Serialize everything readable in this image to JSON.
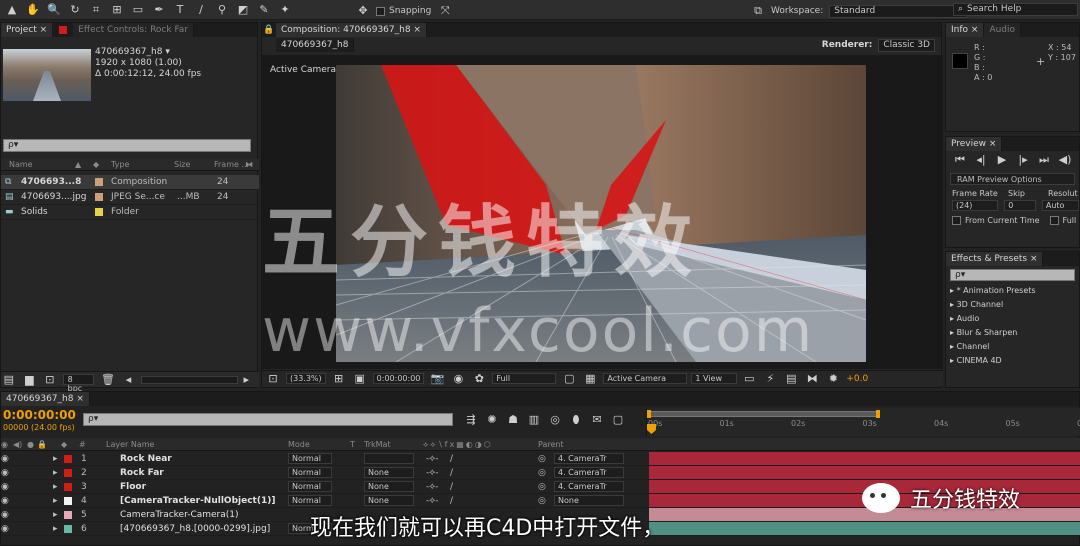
{
  "toolbar": {
    "snapping_label": "Snapping",
    "workspace_label": "Workspace:",
    "workspace_value": "Standard",
    "search_placeholder": "Search Help"
  },
  "project_panel": {
    "tab_project": "Project ×",
    "tab_effect_controls": "Effect Controls: Rock Far",
    "thumb_name": "470669367_h8 ▾",
    "thumb_dims": "1920 x 1080 (1.00)",
    "thumb_duration": "Δ 0:00:12:12, 24.00 fps",
    "col_name": "Name",
    "col_type": "Type",
    "col_size": "Size",
    "col_frame": "Frame ...",
    "items": [
      {
        "name": "4706693...8",
        "type": "Composition",
        "size": "",
        "frame": "24",
        "color": "#c9a27a",
        "icon": "composition-icon"
      },
      {
        "name": "4706693....jpg",
        "type": "JPEG Se...ce",
        "size": "...MB",
        "frame": "24",
        "color": "#c9a27a",
        "icon": "footage-icon"
      },
      {
        "name": "Solids",
        "type": "Folder",
        "size": "",
        "frame": "",
        "color": "#e3d24a",
        "icon": "folder-icon"
      }
    ],
    "bpc": "8 bpc"
  },
  "composition_panel": {
    "tab": "Composition: 470669367_h8 ×",
    "sub_tab": "470669367_h8",
    "renderer_label": "Renderer:",
    "renderer_value": "Classic 3D",
    "active_camera": "Active Camera",
    "zoom": "(33.3%)",
    "timecode": "0:00:00:00",
    "resolution": "Full",
    "camera": "Active Camera",
    "view": "1 View",
    "exposure": "+0.0"
  },
  "info_panel": {
    "tab_info": "Info ×",
    "tab_audio": "Audio",
    "r": "R :",
    "g": "G :",
    "b": "B :",
    "a": "A : 0",
    "x": "X : 54",
    "y": "Y : 107"
  },
  "preview_panel": {
    "tab": "Preview ×",
    "ram_options": "RAM Preview Options",
    "frame_rate_label": "Frame Rate",
    "skip_label": "Skip",
    "resolution_label": "Resolut",
    "frame_rate": "(24)",
    "skip": "0",
    "resolution": "Auto",
    "from_current": "From Current Time",
    "full": "Full"
  },
  "effects_panel": {
    "tab": "Effects & Presets ×",
    "search_placeholder": "ρ▾",
    "items": [
      "* Animation Presets",
      "3D Channel",
      "Audio",
      "Blur & Sharpen",
      "Channel",
      "CINEMA 4D"
    ]
  },
  "timeline": {
    "tab": "470669367_h8 ×",
    "timecode": "0:00:00:00",
    "fps": "00000 (24.00 fps)",
    "col_layer_name": "Layer Name",
    "col_mode": "Mode",
    "col_t": "T",
    "col_trkmat": "TrkMat",
    "col_parent": "Parent",
    "ticks": [
      "00s",
      "01s",
      "02s",
      "03s",
      "04s",
      "05s",
      "06"
    ],
    "layers": [
      {
        "num": "1",
        "name": "Rock Near",
        "color": "#d11c1c",
        "mode": "Normal",
        "trkmat": "",
        "parent": "4. CameraTr",
        "bar": "#a8283a"
      },
      {
        "num": "2",
        "name": "Rock Far",
        "color": "#d11c1c",
        "mode": "Normal",
        "trkmat": "None",
        "parent": "4. CameraTr",
        "bar": "#a8283a"
      },
      {
        "num": "3",
        "name": "Floor",
        "color": "#d11c1c",
        "mode": "Normal",
        "trkmat": "None",
        "parent": "4. CameraTr",
        "bar": "#a8283a"
      },
      {
        "num": "4",
        "name": "[CameraTracker-NullObject(1)]",
        "color": "#f2f2f2",
        "mode": "Normal",
        "trkmat": "None",
        "parent": "None",
        "bar": "#a8283a"
      },
      {
        "num": "5",
        "name": "CameraTracker-Camera(1)",
        "color": "#e8a8b8",
        "mode": "",
        "trkmat": "",
        "parent": "",
        "bar": "#c48b95"
      },
      {
        "num": "6",
        "name": "[470669367_h8.[0000-0299].jpg]",
        "color": "#6bb7a6",
        "mode": "Norm",
        "trkmat": "",
        "parent": "",
        "bar": "#4f8f84"
      }
    ]
  },
  "overlay": {
    "watermark_cn": "五分钱特效",
    "watermark_url": "www.vfxcool.com",
    "brand": "五分钱特效",
    "subtitle": "现在我们就可以再C4D中打开文件，"
  },
  "colors": {
    "label_red": "#d11c1c",
    "bar_red": "#a8283a",
    "accent_orange": "#f0a000"
  }
}
